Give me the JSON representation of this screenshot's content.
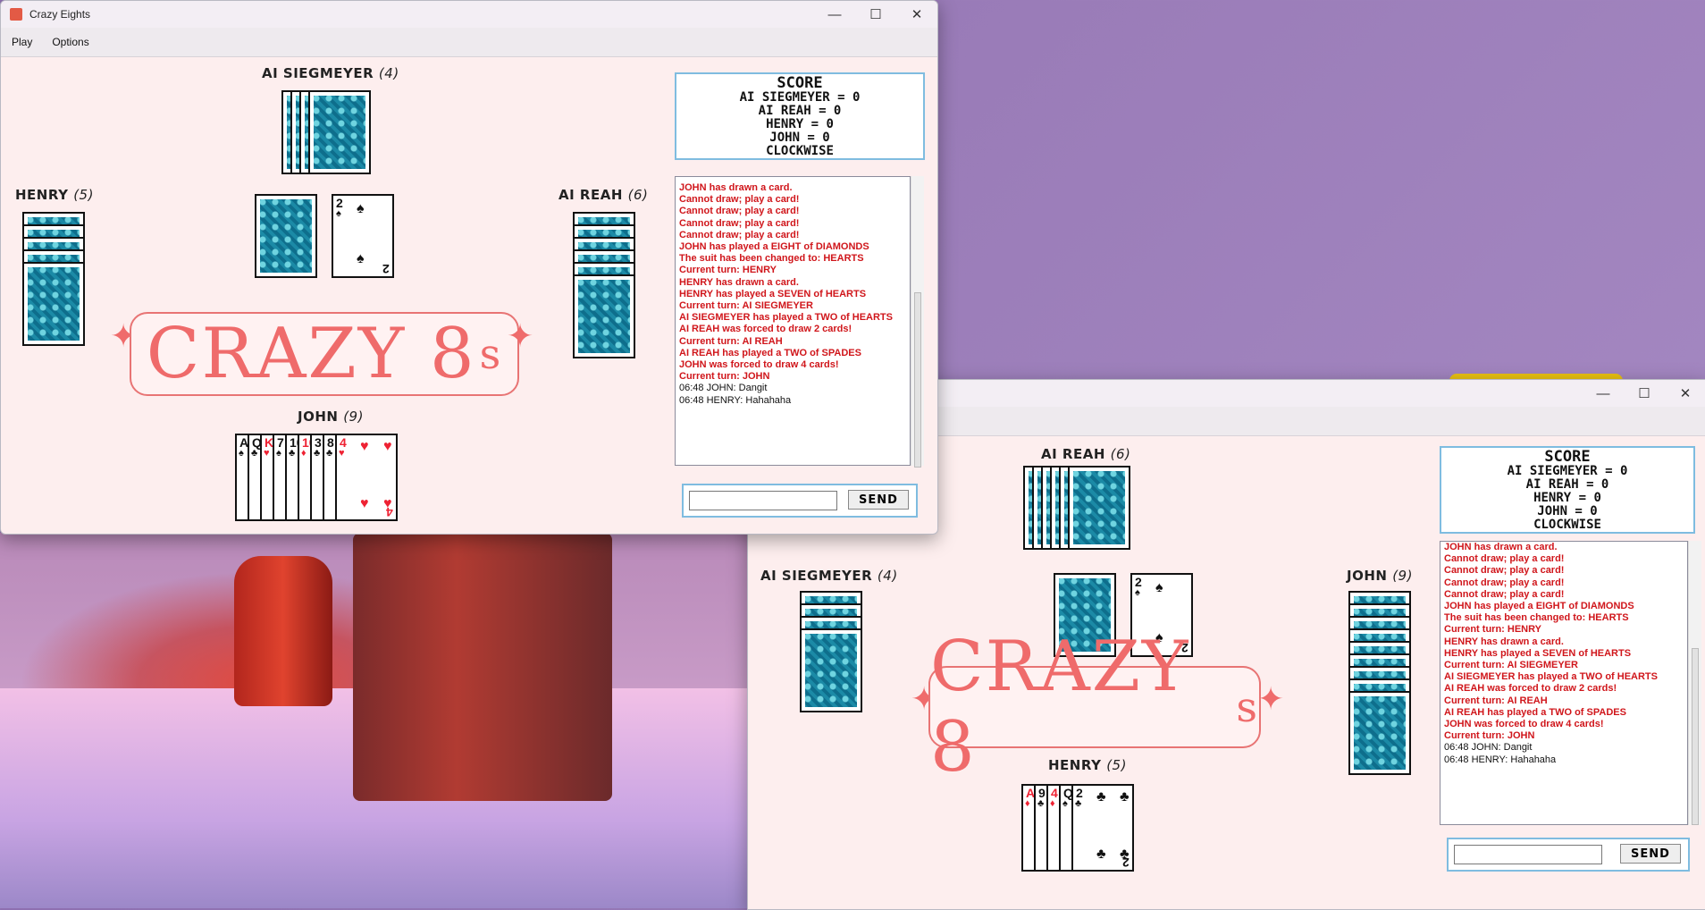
{
  "window1": {
    "title": "Crazy Eights",
    "menu": [
      "Play",
      "Options"
    ],
    "players": {
      "top": {
        "name": "AI SIEGMEYER",
        "count": "(4)"
      },
      "left": {
        "name": "HENRY",
        "count": "(5)"
      },
      "right": {
        "name": "AI REAH",
        "count": "(6)"
      },
      "bottom": {
        "name": "JOHN",
        "count": "(9)"
      }
    },
    "discard": {
      "rank": "2",
      "suit": "♠"
    },
    "hand": [
      {
        "rank": "A",
        "suit": "♠",
        "color": "black"
      },
      {
        "rank": "Q",
        "suit": "♣",
        "color": "black"
      },
      {
        "rank": "K",
        "suit": "♥",
        "color": "red"
      },
      {
        "rank": "7",
        "suit": "♠",
        "color": "black"
      },
      {
        "rank": "10",
        "suit": "♣",
        "color": "black"
      },
      {
        "rank": "10",
        "suit": "♦",
        "color": "red"
      },
      {
        "rank": "3",
        "suit": "♣",
        "color": "black"
      },
      {
        "rank": "8",
        "suit": "♣",
        "color": "black"
      },
      {
        "rank": "4",
        "suit": "♥",
        "color": "red"
      }
    ],
    "logo": {
      "main": "CRAZY 8",
      "small": "s"
    },
    "score": {
      "heading": "SCORE",
      "lines": [
        "AI SIEGMEYER = 0",
        "AI REAH = 0",
        "HENRY = 0",
        "JOHN = 0",
        "CLOCKWISE"
      ]
    },
    "send_label": "SEND",
    "chat_value": ""
  },
  "window2": {
    "title": "",
    "players": {
      "top": {
        "name": "AI REAH",
        "count": "(6)"
      },
      "left": {
        "name": "AI SIEGMEYER",
        "count": "(4)"
      },
      "right": {
        "name": "JOHN",
        "count": "(9)"
      },
      "bottom": {
        "name": "HENRY",
        "count": "(5)"
      }
    },
    "discard": {
      "rank": "2",
      "suit": "♠"
    },
    "hand": [
      {
        "rank": "A",
        "suit": "♦",
        "color": "red"
      },
      {
        "rank": "9",
        "suit": "♣",
        "color": "black"
      },
      {
        "rank": "4",
        "suit": "♦",
        "color": "red"
      },
      {
        "rank": "Q",
        "suit": "♠",
        "color": "black"
      },
      {
        "rank": "2",
        "suit": "♣",
        "color": "black"
      }
    ],
    "logo": {
      "main": "CRAZY 8",
      "small": "s"
    },
    "score": {
      "heading": "SCORE",
      "lines": [
        "AI SIEGMEYER = 0",
        "AI REAH = 0",
        "HENRY = 0",
        "JOHN = 0",
        "CLOCKWISE"
      ]
    },
    "send_label": "SEND",
    "chat_value": ""
  },
  "log": [
    {
      "text": "JOHN has drawn a card.",
      "style": "red"
    },
    {
      "text": "Cannot draw; play a card!",
      "style": "red"
    },
    {
      "text": "Cannot draw; play a card!",
      "style": "red"
    },
    {
      "text": "Cannot draw; play a card!",
      "style": "red"
    },
    {
      "text": "Cannot draw; play a card!",
      "style": "red"
    },
    {
      "text": "JOHN has played a EIGHT of DIAMONDS",
      "style": "red"
    },
    {
      "text": "The suit has been changed to:  HEARTS",
      "style": "red"
    },
    {
      "text": "Current turn: HENRY",
      "style": "red"
    },
    {
      "text": "HENRY has drawn a card.",
      "style": "red"
    },
    {
      "text": "HENRY has played a SEVEN of HEARTS",
      "style": "red"
    },
    {
      "text": "Current turn: AI SIEGMEYER",
      "style": "red"
    },
    {
      "text": "AI SIEGMEYER has played a TWO of HEARTS",
      "style": "red"
    },
    {
      "text": "AI REAH was forced to draw 2 cards!",
      "style": "red"
    },
    {
      "text": "Current turn: AI REAH",
      "style": "red"
    },
    {
      "text": "AI REAH has played a TWO of SPADES",
      "style": "red"
    },
    {
      "text": "JOHN was forced to draw 4 cards!",
      "style": "red"
    },
    {
      "text": "Current turn: JOHN",
      "style": "red"
    },
    {
      "text": "06:48 JOHN: Dangit",
      "style": "normal"
    },
    {
      "text": "06:48 HENRY: Hahahaha",
      "style": "normal"
    }
  ]
}
